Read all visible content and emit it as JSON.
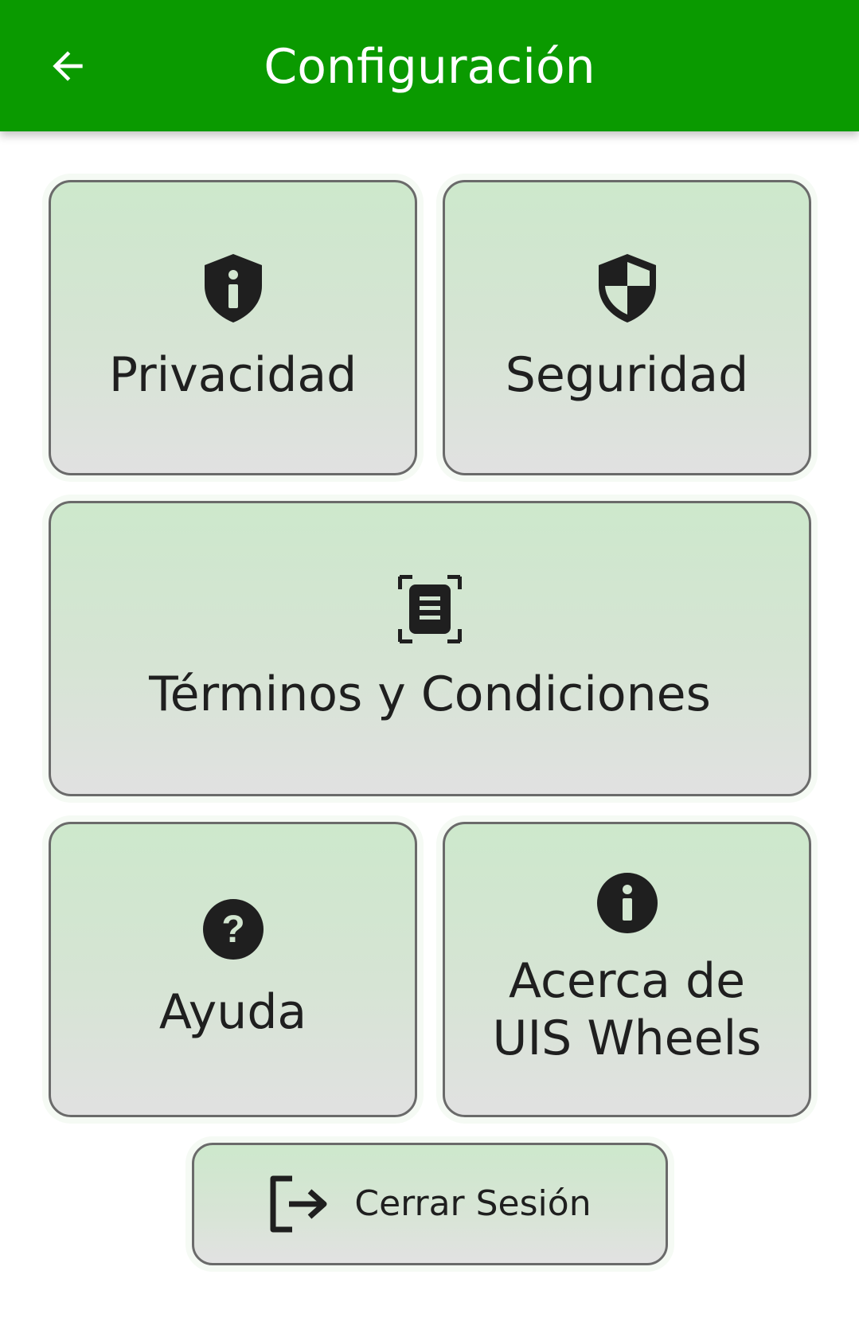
{
  "header": {
    "title": "Configuración",
    "back_icon": "arrow-left-icon",
    "background": "#0a9a00",
    "text_color": "#ffffff"
  },
  "cards": {
    "privacidad": {
      "label": "Privacidad",
      "icon": "shield-info-icon"
    },
    "seguridad": {
      "label": "Seguridad",
      "icon": "security-shield-icon"
    },
    "terminos": {
      "label": "Términos y Condiciones",
      "icon": "document-scan-icon"
    },
    "ayuda": {
      "label": "Ayuda",
      "icon": "help-circle-icon"
    },
    "acerca": {
      "label": "Acerca de UIS Wheels",
      "icon": "info-circle-icon"
    }
  },
  "logout": {
    "label": "Cerrar Sesión",
    "icon": "logout-icon"
  },
  "colors": {
    "card_top": "#cde8cc",
    "card_bottom": "#e1e1e1",
    "card_border": "#6a6a6a",
    "icon": "#1f1f1f"
  }
}
